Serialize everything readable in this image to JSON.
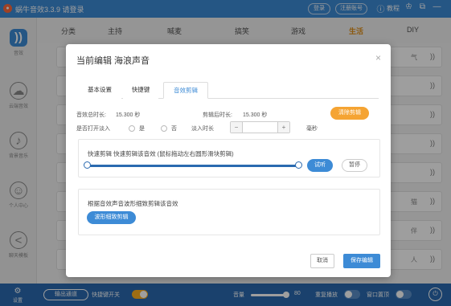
{
  "titlebar": {
    "title": "蜗牛音效3.3.9 请登录",
    "login": "登录",
    "register": "注册账号",
    "tutorial": "教程",
    "help_icon": "question-circle-icon",
    "shirt_icon": "tshirt-icon",
    "export_icon": "window-export-icon",
    "minimize": "—",
    "accent": "#3d8bd6"
  },
  "sidebar": {
    "items": [
      {
        "label": "音效",
        "icon": "sound-wave-icon",
        "glyph": "))"
      },
      {
        "label": "云端音效",
        "icon": "cloud-icon",
        "glyph": "☁"
      },
      {
        "label": "背景音乐",
        "icon": "music-disc-icon",
        "glyph": "♪"
      },
      {
        "label": "个人中心",
        "icon": "user-icon",
        "glyph": "☺"
      },
      {
        "label": "聊天模板",
        "icon": "share-icon",
        "glyph": "<"
      }
    ]
  },
  "categories": {
    "label": "分类",
    "items": [
      {
        "label": "主持",
        "icon": "mic-icon"
      },
      {
        "label": "喊麦",
        "icon": "horn-icon"
      },
      {
        "label": "搞笑",
        "icon": "smile-icon"
      },
      {
        "label": "游戏",
        "icon": "gamepad-icon"
      },
      {
        "label": "生活",
        "icon": "cup-icon"
      },
      {
        "label": "DIY",
        "icon": "puzzle-icon"
      }
    ]
  },
  "list": {
    "wave_glyph": "))",
    "mid_glyphs": [
      "气",
      "",
      "",
      "",
      "",
      "猫",
      "伴",
      "人"
    ]
  },
  "bottombar": {
    "settings": "设置",
    "exit_channel": "输出通道",
    "hotkey_switch": "快捷键开关",
    "volume_label": "音量",
    "volume_value": "80",
    "repeat_play": "重复播放",
    "window_topmost": "窗口置顶",
    "volume_level": 0.8
  },
  "dialog": {
    "title": "当前编辑 海浪声音",
    "tabs": [
      "基本设置",
      "快捷键",
      "音效剪辑"
    ],
    "total_duration_label": "音效总时长:",
    "total_duration_value": "15.300 秒",
    "clip_duration_label": "剪辑后时长:",
    "clip_duration_value": "15.300 秒",
    "clear_clip": "清除剪辑",
    "fade_in_label": "是否打开淡入",
    "yes": "是",
    "no": "否",
    "fade_in_duration": "淡入时长",
    "stepper_value": "",
    "minus": "−",
    "plus": "+",
    "unit_ms": "毫秒",
    "quick_clip_desc": "快速剪辑 快速剪辑该音效 (鼠标拖动左右圆形滑块剪辑)",
    "audition": "试听",
    "pause": "暂停",
    "waveform_desc": "根据音效声音波形细致剪辑该音效",
    "waveform_btn": "波形细致剪辑",
    "cancel": "取消",
    "save": "保存编辑",
    "clip_start": 0.0,
    "clip_end": 1.0
  }
}
